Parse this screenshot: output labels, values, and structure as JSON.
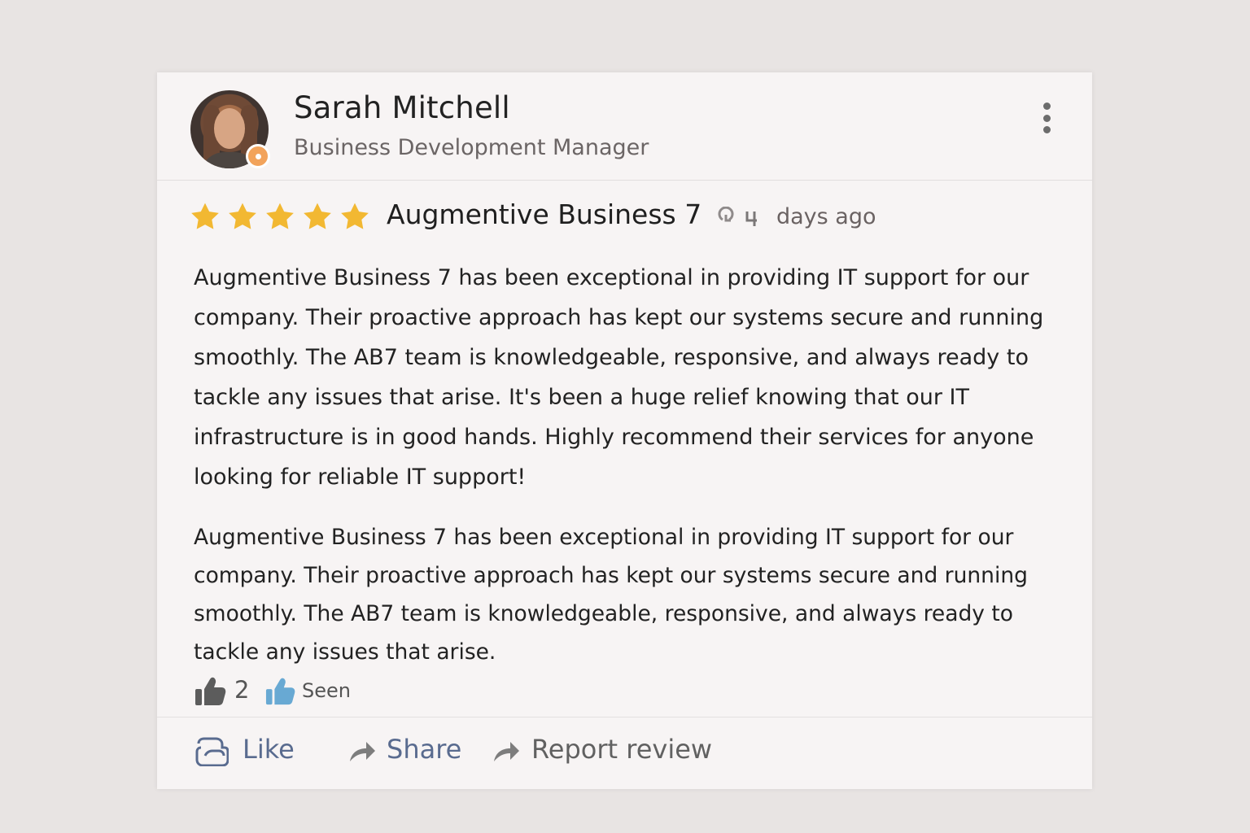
{
  "review_card": {
    "author": {
      "name": "Sarah Mitchell",
      "title": "Business Development Manager",
      "avatar": "profile-photo",
      "badge_icon": "award-icon"
    },
    "menu_icon": "more-vertical-icon",
    "rating": {
      "value": 5,
      "max": 5,
      "star_color": "#f2b832"
    },
    "company": "Augmentive Business 7",
    "time_ago": "days ago",
    "paragraphs": [
      "Augmentive Business 7 has been exceptional in providing IT support for our company. Their proactive approach has kept our systems secure and running smoothly. The AB7 team is knowledgeable, responsive, and always ready to tackle any issues that arise. It's been a huge relief knowing that our IT infrastructure is in good hands. Highly recommend their services for anyone looking for reliable IT support!",
      "Augmentive Business 7 has been exceptional in providing IT support for our company. Their proactive approach has kept our systems secure and running smoothly. The AB7 team is knowledgeable, responsive, and always ready to tackle any issues that arise."
    ],
    "reactions": {
      "likes": "2",
      "seen_label": "Seen"
    },
    "actions": {
      "like": "Like",
      "share": "Share",
      "report": "Report review"
    },
    "colors": {
      "accent": "#596b8f",
      "thumb_blue": "#68a9d3",
      "badge": "#f2a35b"
    }
  }
}
